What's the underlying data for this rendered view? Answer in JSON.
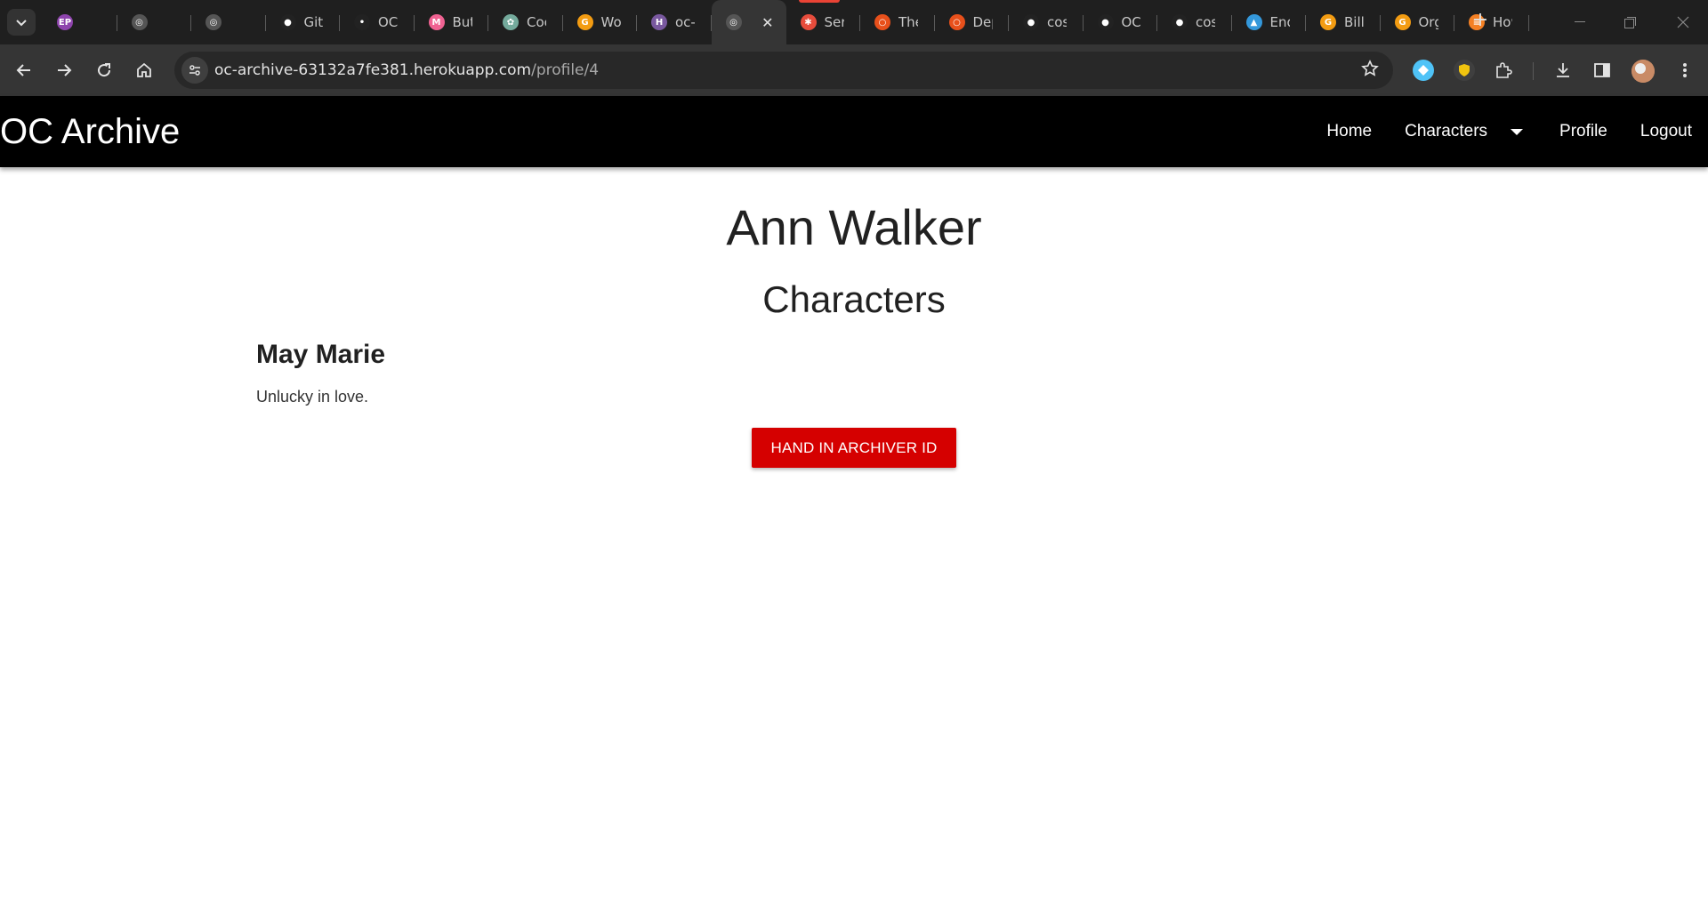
{
  "browser": {
    "tabs": [
      {
        "title": "",
        "fav": "EP",
        "color": "#8e44ad"
      },
      {
        "title": "",
        "fav": "globe",
        "color": "#555"
      },
      {
        "title": "",
        "fav": "globe",
        "color": "#555"
      },
      {
        "title": "Gitl",
        "fav": "github",
        "color": "#222"
      },
      {
        "title": "OC",
        "fav": "git",
        "color": "#222"
      },
      {
        "title": "Butt",
        "fav": "m",
        "color": "#f06292"
      },
      {
        "title": "Coc",
        "fav": "gpt",
        "color": "#74aa9c"
      },
      {
        "title": "Wor",
        "fav": "g",
        "color": "#f39c12"
      },
      {
        "title": "oc-a",
        "fav": "H",
        "color": "#79589f"
      },
      {
        "title": "",
        "fav": "globe",
        "color": "#555",
        "active": true
      },
      {
        "title": "Serv",
        "fav": "bug",
        "color": "#e74c3c",
        "playing": true
      },
      {
        "title": "The",
        "fav": "o",
        "color": "#e8501b"
      },
      {
        "title": "Dep",
        "fav": "o",
        "color": "#e8501b"
      },
      {
        "title": "cosi",
        "fav": "github",
        "color": "#222"
      },
      {
        "title": "OC-",
        "fav": "github",
        "color": "#222"
      },
      {
        "title": "cosi",
        "fav": "github",
        "color": "#222"
      },
      {
        "title": "End",
        "fav": "fire",
        "color": "#3498db"
      },
      {
        "title": "Billi",
        "fav": "g",
        "color": "#f39c12"
      },
      {
        "title": "Org",
        "fav": "g",
        "color": "#f39c12"
      },
      {
        "title": "How",
        "fav": "so",
        "color": "#f48024"
      }
    ],
    "url_host": "oc-archive-63132a7fe381.herokuapp.com",
    "url_path": "/profile/4"
  },
  "site": {
    "brand": "OC Archive",
    "nav": {
      "home": "Home",
      "characters": "Characters",
      "profile": "Profile",
      "logout": "Logout"
    }
  },
  "profile": {
    "owner_name": "Ann Walker",
    "section_title": "Characters",
    "characters": [
      {
        "name": "May Marie",
        "description": "Unlucky in love."
      }
    ],
    "action_button": "HAND IN ARCHIVER ID"
  },
  "colors": {
    "navbar_bg": "#000000",
    "button_bg": "#d50000"
  }
}
